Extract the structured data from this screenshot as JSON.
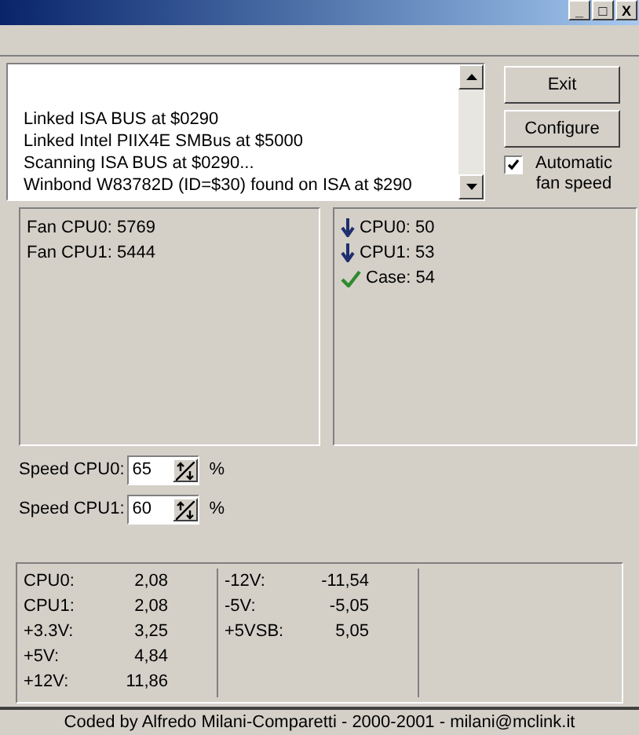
{
  "window": {
    "controls": [
      "_",
      "□",
      "X"
    ]
  },
  "log": {
    "lines": [
      "Linked ISA BUS at $0290",
      "Linked Intel PIIX4E SMBus at $5000",
      "Scanning ISA BUS at $0290...",
      "Winbond W83782D (ID=$30) found on ISA at $290"
    ]
  },
  "buttons": [
    "Exit",
    "Configure"
  ],
  "automatic_fan_speed": {
    "label": "Automatic fan speed",
    "checked": true
  },
  "fans": [
    "Fan CPU0: 5769",
    "Fan CPU1: 5444"
  ],
  "temperatures": [
    {
      "kind": "falling",
      "text": "CPU0: 50"
    },
    {
      "kind": "falling",
      "text": "CPU1: 53"
    },
    {
      "kind": "ok",
      "text": "Case:  54"
    }
  ],
  "speeds": [
    {
      "label": "Speed CPU0:",
      "value": "65",
      "unit": "%"
    },
    {
      "label": "Speed CPU1:",
      "value": "60",
      "unit": "%"
    }
  ],
  "voltages": [
    [
      {
        "label": "CPU0:",
        "value": "2,08"
      },
      {
        "label": "CPU1:",
        "value": "2,08"
      },
      {
        "label": "+3.3V:",
        "value": "3,25"
      },
      {
        "label": "+5V:",
        "value": "4,84"
      },
      {
        "label": "+12V:",
        "value": "11,86"
      }
    ],
    [
      {
        "label": "-12V:",
        "value": "-11,54"
      },
      {
        "label": "-5V:",
        "value": "-5,05"
      },
      {
        "label": "+5VSB:",
        "value": "5,05"
      }
    ]
  ],
  "status_bar": "Coded by Alfredo Milani-Comparetti - 2000-2001 - milani@mclink.it"
}
